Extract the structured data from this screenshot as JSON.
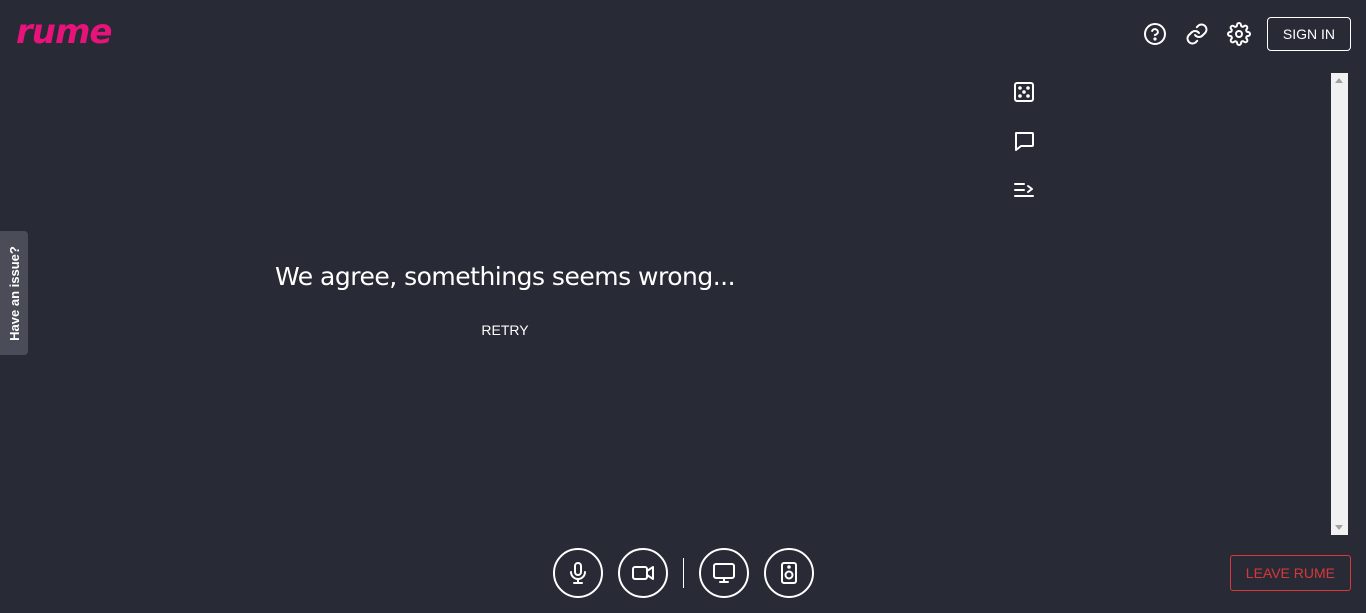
{
  "app": {
    "logo": "rume",
    "accent_color": "#e7127a"
  },
  "header": {
    "help_icon": "help-circle-icon",
    "link_icon": "link-icon",
    "settings_icon": "gear-icon",
    "sign_in_label": "SIGN IN"
  },
  "side_tools": {
    "dice_icon": "dice-icon",
    "chat_icon": "chat-bubble-icon",
    "queue_icon": "queue-list-icon"
  },
  "issue_tab": {
    "label": "Have an issue?"
  },
  "main": {
    "error_message": "We agree, somethings seems wrong...",
    "retry_label": "RETRY"
  },
  "controls": {
    "mic_icon": "microphone-icon",
    "camera_icon": "video-camera-icon",
    "screen_icon": "monitor-icon",
    "speaker_icon": "speaker-icon"
  },
  "footer": {
    "leave_label": "LEAVE RUME",
    "leave_color": "#d8383a"
  }
}
